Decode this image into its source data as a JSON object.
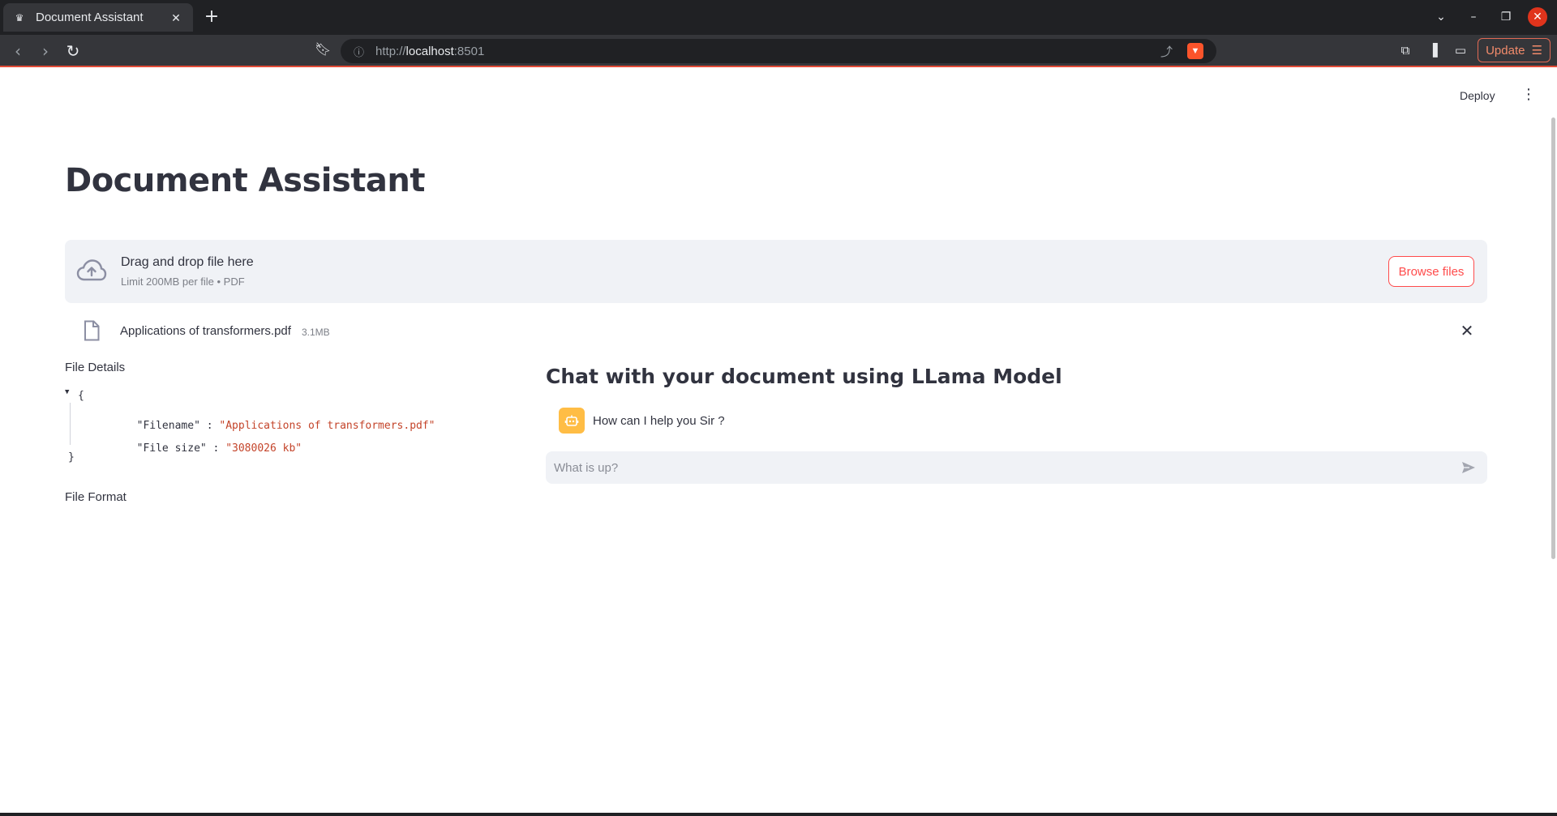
{
  "browser": {
    "tab_title": "Document Assistant",
    "tab_favicon": "streamlit-crown-icon",
    "url_scheme": "http://",
    "url_host": "localhost",
    "url_port": ":8501",
    "update_label": "Update"
  },
  "header": {
    "deploy_label": "Deploy"
  },
  "page": {
    "title": "Document Assistant"
  },
  "uploader": {
    "title": "Drag and drop file here",
    "limit": "Limit 200MB per file • PDF",
    "browse_label": "Browse files"
  },
  "uploaded_file": {
    "name": "Applications of transformers.pdf",
    "size": "3.1MB"
  },
  "file_details": {
    "label": "File Details",
    "json": {
      "open": "{",
      "close": "}",
      "rows": [
        {
          "key": "\"Filename\"",
          "sep": " : ",
          "value": "\"Applications of transformers.pdf\""
        },
        {
          "key": "\"File size\"",
          "sep": " : ",
          "value": "\"3080026 kb\""
        }
      ]
    },
    "format_label": "File Format"
  },
  "chat": {
    "title": "Chat with your document using LLama Model",
    "messages": [
      {
        "role": "assistant",
        "avatar": "robot-icon",
        "text": "How can I help you Sir ?"
      }
    ],
    "input_placeholder": "What is up?"
  },
  "colors": {
    "primary": "#ff4b4b",
    "text": "#31333f",
    "secondary_bg": "#f0f2f6",
    "json_value": "#c4442a",
    "bot_avatar": "#ffbd45"
  }
}
